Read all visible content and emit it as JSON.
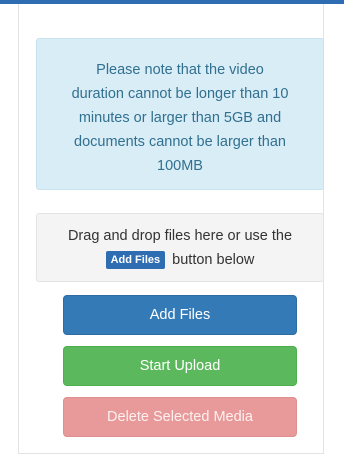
{
  "notice": {
    "lines": [
      "Please note that the video",
      "duration cannot be longer than 10",
      "minutes or larger than 5GB and",
      "documents cannot be larger than",
      "100MB"
    ]
  },
  "dropzone": {
    "line1": "Drag and drop files here or use the",
    "badge_label": "Add Files",
    "line2_suffix": "button below"
  },
  "buttons": {
    "add_files": "Add Files",
    "start_upload": "Start Upload",
    "delete_selected": "Delete Selected Media"
  },
  "colors": {
    "primary": "#337ab7",
    "success": "#5cb85c",
    "danger_disabled": "#e79a99",
    "info_bg": "#d9edf7",
    "info_text": "#31708f"
  }
}
